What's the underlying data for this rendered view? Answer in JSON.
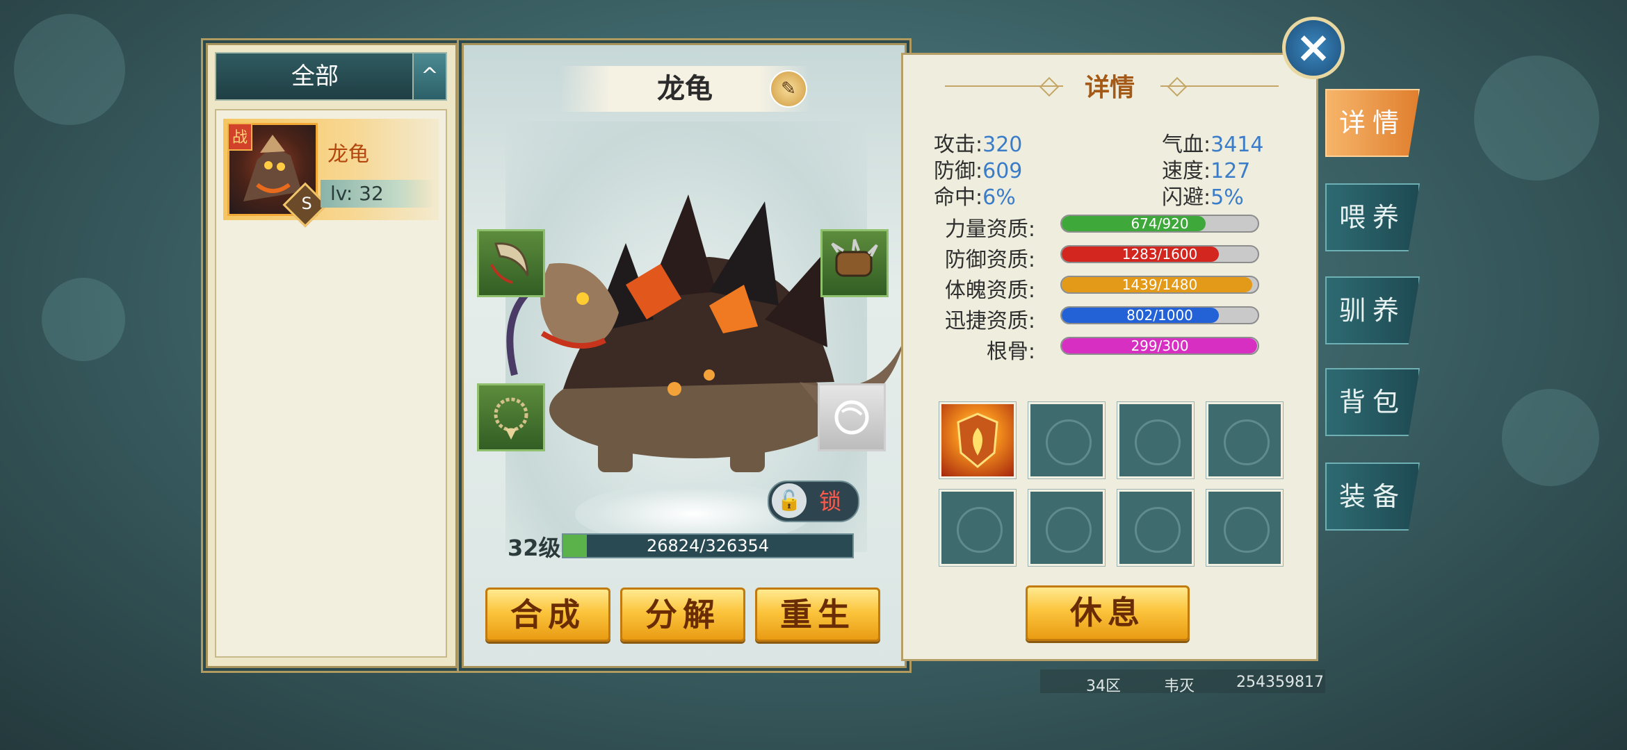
{
  "list": {
    "filter_label": "全部",
    "collapse_icon": "^",
    "items": [
      {
        "badge": "战",
        "rank": "S",
        "name": "龙龟",
        "level_text": "lv: 32"
      }
    ]
  },
  "center": {
    "pet_name": "龙龟",
    "rename_icon": "✎",
    "lock_label": "锁",
    "level_label": "32级",
    "exp_text": "26824/326354",
    "exp_fraction": 0.082,
    "buttons": {
      "compose": "合成",
      "decompose": "分解",
      "rebirth": "重生"
    }
  },
  "details": {
    "title": "详情",
    "stats": {
      "attack_label": "攻击:",
      "attack": "320",
      "hp_label": "气血:",
      "hp": "3414",
      "defense_label": "防御:",
      "defense": "609",
      "speed_label": "速度:",
      "speed": "127",
      "hit_label": "命中:",
      "hit": "6%",
      "dodge_label": "闪避:",
      "dodge": "5%"
    },
    "aptitudes": [
      {
        "label": "力量资质:",
        "value": "674/920",
        "fraction": 0.733,
        "color": "#3fa83a"
      },
      {
        "label": "防御资质:",
        "value": "1283/1600",
        "fraction": 0.802,
        "color": "#d2261f"
      },
      {
        "label": "体魄资质:",
        "value": "1439/1480",
        "fraction": 0.972,
        "color": "#e39a18"
      },
      {
        "label": "迅捷资质:",
        "value": "802/1000",
        "fraction": 0.802,
        "color": "#2361d6"
      },
      {
        "label": "根骨:",
        "value": "299/300",
        "fraction": 0.997,
        "color": "#d82fc3"
      }
    ],
    "rest_button": "休息"
  },
  "tabs": {
    "details": "详情",
    "feed": "喂养",
    "train": "驯养",
    "bag": "背包",
    "equip": "装备"
  },
  "close_icon": "×",
  "footer": {
    "server": "34区",
    "player": "韦灭",
    "player_id": "254359817"
  }
}
